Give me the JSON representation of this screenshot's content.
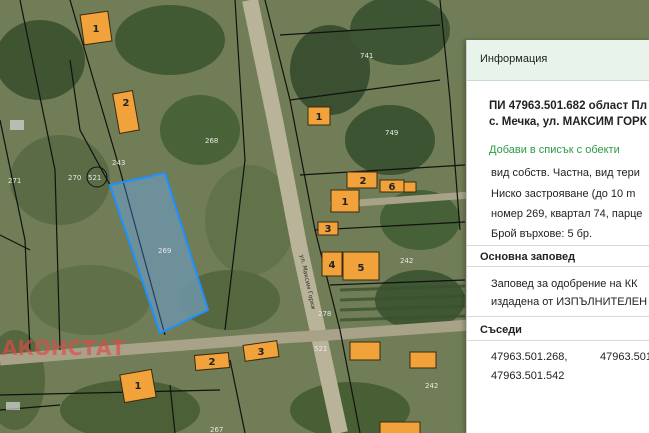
{
  "map": {
    "buildings": [
      {
        "label": "1"
      },
      {
        "label": "2"
      },
      {
        "label": "1"
      },
      {
        "label": "2"
      },
      {
        "label": "6"
      },
      {
        "label": "1"
      },
      {
        "label": "3"
      },
      {
        "label": "4"
      },
      {
        "label": "5"
      },
      {
        "label": "2"
      },
      {
        "label": "3"
      },
      {
        "label": "1"
      }
    ],
    "parcel_numbers": [
      "269",
      "268",
      "271",
      "270",
      "521",
      "741",
      "749",
      "242",
      "278",
      "521",
      "242",
      "267",
      "243"
    ],
    "street_label": "ул. Максим Горки",
    "watermark": "АКОНСТАТ",
    "colors": {
      "building_fill": "#f2a23a",
      "building_stroke": "#3a2a10",
      "selected_parcel_stroke": "#1e90ff",
      "selected_parcel_fill": "rgba(60,150,255,0.35)",
      "boundary": "#111111",
      "watermark": "#e14a4a"
    }
  },
  "panel": {
    "header": "Информация",
    "title_line1": "ПИ 47963.501.682 област Пл",
    "title_line2": "с. Мечка, ул. МАКСИМ ГОРК",
    "add_link": "Добави в списък с обекти",
    "desc": [
      "вид собств. Частна, вид тери",
      "Ниско застрояване (до 10 m",
      "номер 269, квартал 74, парце",
      "Брой върхове: 5 бр."
    ],
    "order_title": "Основна заповед",
    "order_lines": [
      "Заповед за одобрение на КК",
      "издадена от ИЗПЪЛНИТЕЛЕН Д"
    ],
    "neighbors_title": "Съседи",
    "neighbors": [
      "47963.501.268,",
      "47963.501",
      "47963.501.542"
    ]
  }
}
